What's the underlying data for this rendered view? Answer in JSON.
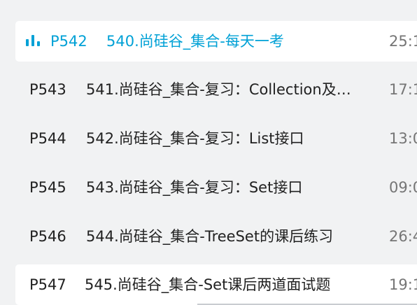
{
  "colors": {
    "accent": "#00a1d6",
    "text": "#212121",
    "duration": "#757575",
    "background": "#f1f2f3"
  },
  "playlist": {
    "items": [
      {
        "ep": "P542",
        "title": "540.尚硅谷_集合-每天一考",
        "duration": "25:1",
        "active": true
      },
      {
        "ep": "P543",
        "title": "541.尚硅谷_集合-复习：Collection及…",
        "duration": "17:1",
        "active": false
      },
      {
        "ep": "P544",
        "title": "542.尚硅谷_集合-复习：List接口",
        "duration": "13:0",
        "active": false
      },
      {
        "ep": "P545",
        "title": "543.尚硅谷_集合-复习：Set接口",
        "duration": "09:0",
        "active": false
      },
      {
        "ep": "P546",
        "title": "544.尚硅谷_集合-TreeSet的课后练习",
        "duration": "26:4",
        "active": false
      },
      {
        "ep": "P547",
        "title": "545.尚硅谷_集合-Set课后两道面试题",
        "duration": "19:1",
        "active": false
      }
    ]
  },
  "icons": {
    "playing": "playing-bars-icon"
  }
}
